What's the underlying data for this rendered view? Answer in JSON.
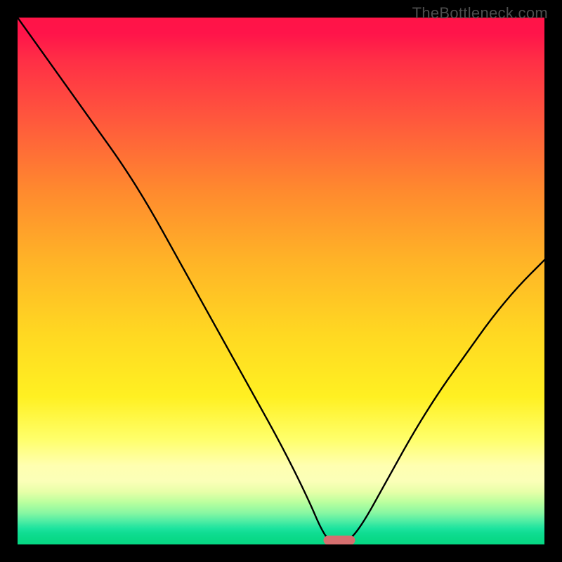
{
  "watermark": {
    "text": "TheBottleneck.com"
  },
  "chart_data": {
    "type": "line",
    "title": "",
    "xlabel": "",
    "ylabel": "",
    "xlim": [
      0,
      100
    ],
    "ylim": [
      0,
      100
    ],
    "grid": false,
    "legend": false,
    "series": [
      {
        "name": "bottleneck-curve",
        "x": [
          0,
          5,
          10,
          15,
          20,
          25,
          30,
          35,
          40,
          45,
          50,
          55,
          58,
          60,
          62,
          65,
          70,
          75,
          80,
          85,
          90,
          95,
          100
        ],
        "values": [
          100,
          93,
          86,
          79,
          72,
          64,
          55,
          46,
          37,
          28,
          19,
          9,
          2,
          0,
          0,
          3,
          12,
          21,
          29,
          36,
          43,
          49,
          54
        ]
      }
    ],
    "marker": {
      "x_center": 61,
      "y": 0,
      "width_pct": 6,
      "color": "#d66f6f"
    },
    "background_gradient": {
      "top": "#ff1447",
      "mid_upper": "#ff8a2e",
      "mid": "#ffd822",
      "mid_lower": "#ffff6a",
      "bottom": "#06d783"
    }
  },
  "colors": {
    "frame": "#000000",
    "curve": "#000000",
    "watermark": "#4d4d4d",
    "marker": "#d66f6f"
  }
}
